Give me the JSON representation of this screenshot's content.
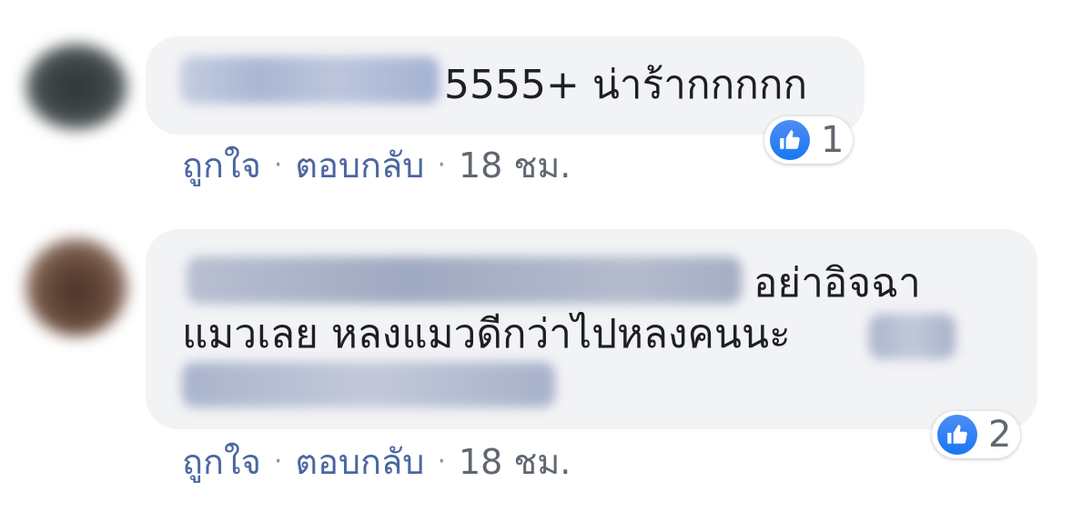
{
  "comments": [
    {
      "text": "5555+ น่าร้ากกกกก",
      "reaction_count": "1",
      "actions": {
        "like": "ถูกใจ",
        "reply": "ตอบกลับ",
        "time": "18 ชม."
      }
    },
    {
      "text_line1": "อย่าอิจฉา",
      "text_line2": "แมวเลย หลงแมวดีกว่าไปหลงคนนะ",
      "reaction_count": "2",
      "actions": {
        "like": "ถูกใจ",
        "reply": "ตอบกลับ",
        "time": "18 ชม."
      }
    }
  ],
  "icons": {
    "reaction": "like-icon"
  },
  "colors": {
    "bubble": "#f2f3f5",
    "link": "#4b67a1",
    "like_blue": "#1877f2",
    "meta_gray": "#606770"
  }
}
